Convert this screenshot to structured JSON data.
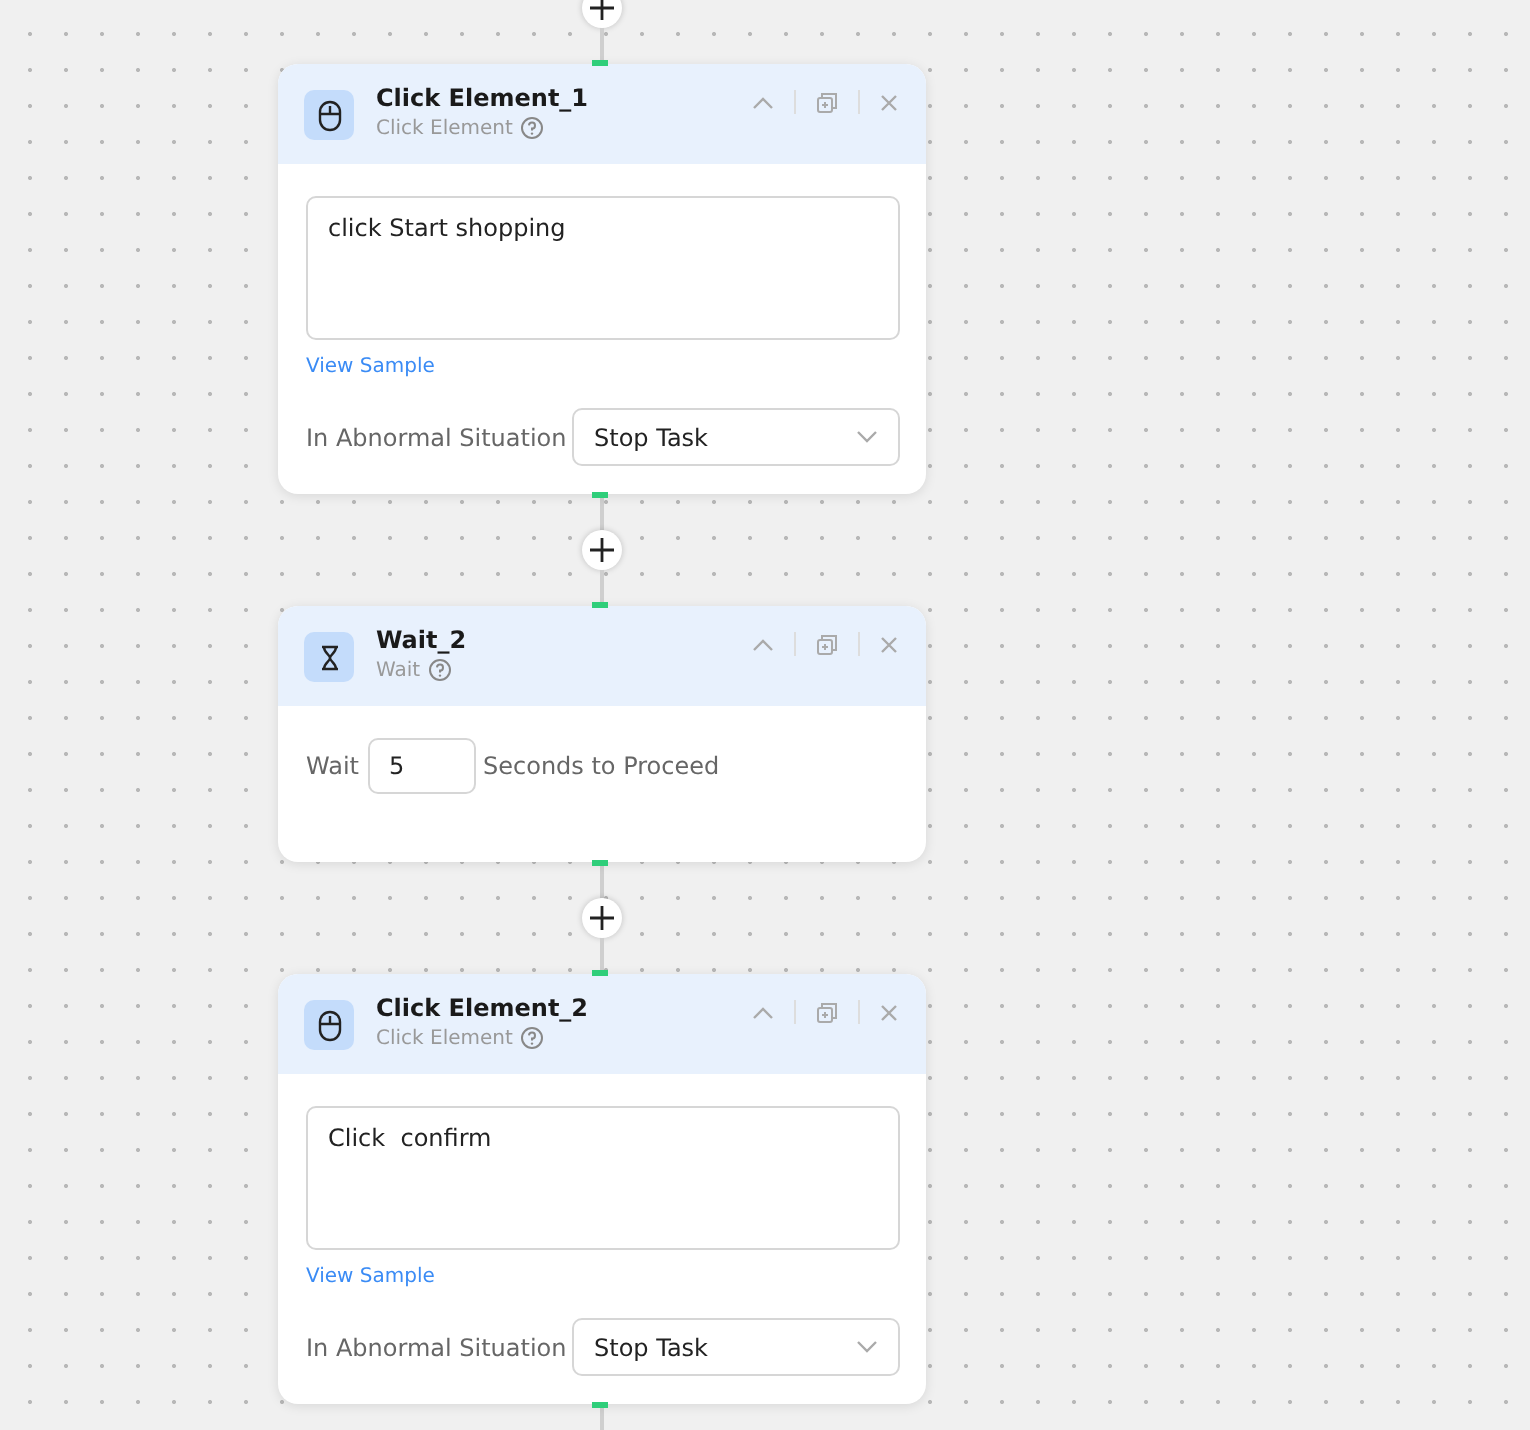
{
  "nodes": [
    {
      "kind": "click",
      "title": "Click Element_1",
      "type_label": "Click Element",
      "instruction": "click Start shopping",
      "link": "View Sample",
      "abnormal_label": "In Abnormal Situation",
      "abnormal_value": "Stop Task"
    },
    {
      "kind": "wait",
      "title": "Wait_2",
      "type_label": "Wait",
      "before": "Wait",
      "value": "5",
      "after": "Seconds to Proceed"
    },
    {
      "kind": "click",
      "title": "Click Element_2",
      "type_label": "Click Element",
      "instruction": "Click  confirm",
      "link": "View Sample",
      "abnormal_label": "In Abnormal Situation",
      "abnormal_value": "Stop Task"
    }
  ]
}
